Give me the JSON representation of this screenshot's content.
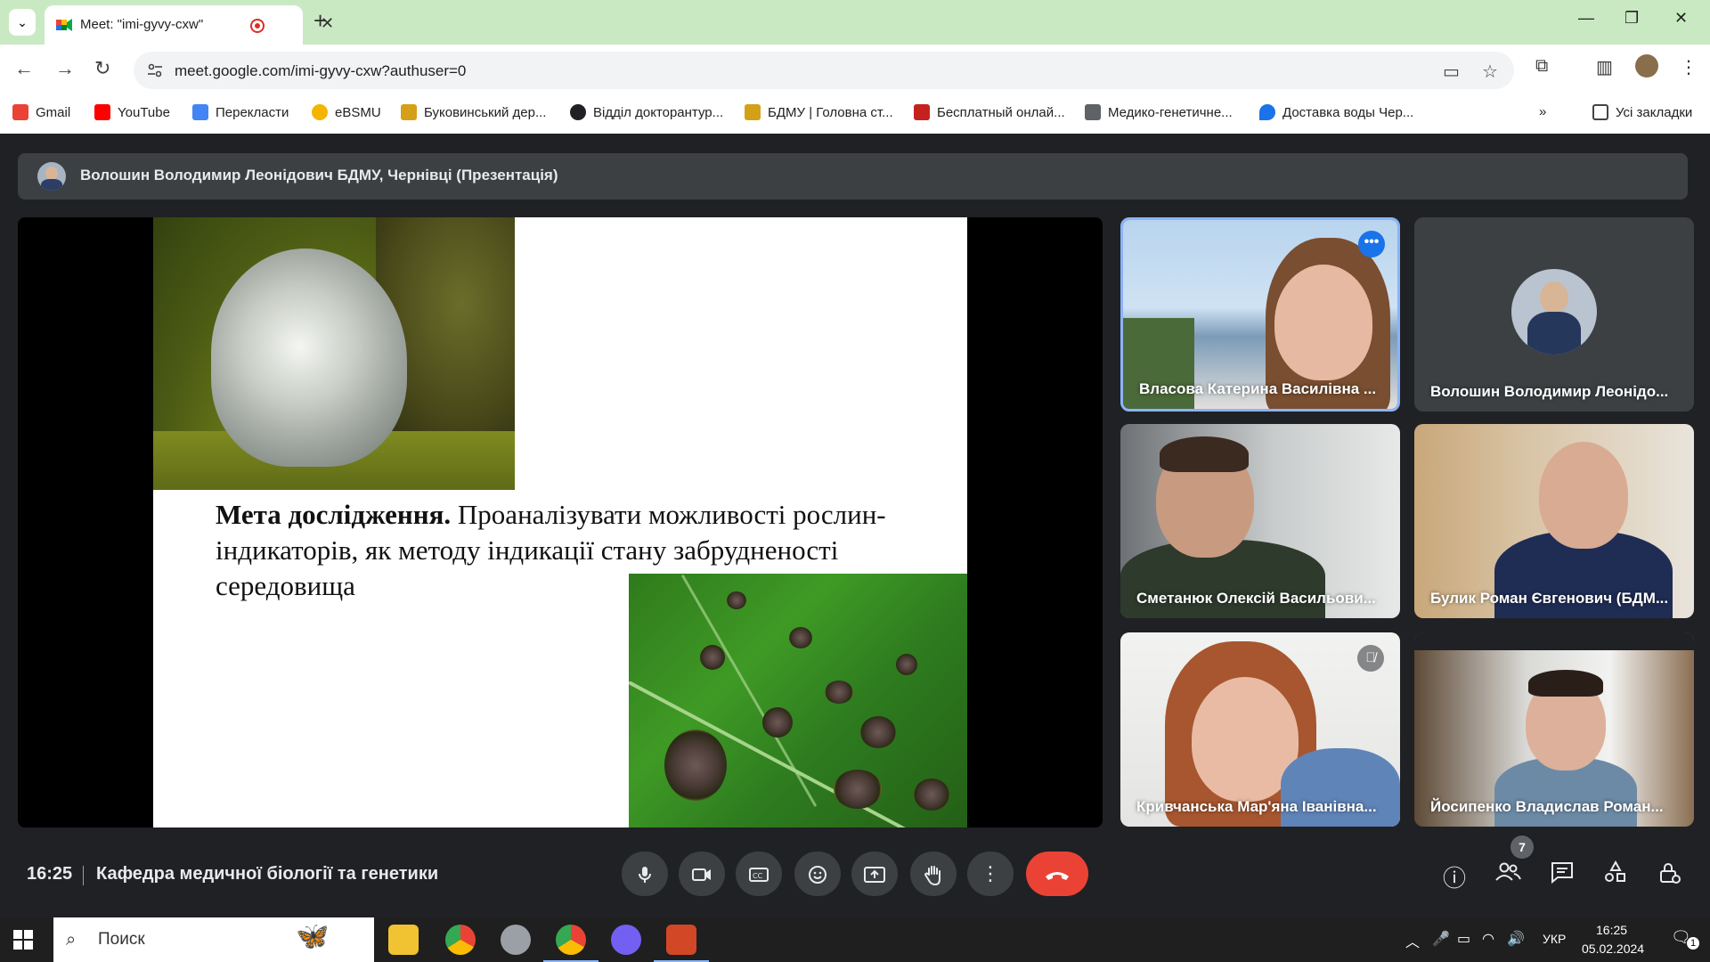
{
  "browser": {
    "tab_title": "Meet: \"imi-gyvy-cxw\"",
    "url": "meet.google.com/imi-gyvy-cxw?authuser=0",
    "bookmarks": [
      {
        "label": "Gmail",
        "color": "#ea4335"
      },
      {
        "label": "YouTube",
        "color": "#ff0000"
      },
      {
        "label": "Перекласти",
        "color": "#4285f4"
      },
      {
        "label": "eBSMU",
        "color": "#f4b400"
      },
      {
        "label": "Буковинський дер...",
        "color": "#f4b400"
      },
      {
        "label": "Відділ докторантур...",
        "color": "#202124"
      },
      {
        "label": "БДМУ | Головна ст...",
        "color": "#d4a017"
      },
      {
        "label": "Бесплатный онлай...",
        "color": "#c5221f"
      },
      {
        "label": "Медико-генетичне...",
        "color": "#5f6368"
      },
      {
        "label": "Доставка воды Чер...",
        "color": "#1a73e8"
      }
    ],
    "all_bookmarks": "Усі закладки"
  },
  "meet": {
    "presenter_bar": "Волошин Володимир Леонідович БДМУ, Чернівці (Презентація)",
    "slide": {
      "heading": "Мета дослідження.",
      "body": " Проаналізувати можливості рослин-індикаторів, як методу індикації стану забрудненості середовища"
    },
    "participants": [
      {
        "name": "Власова Катерина Василівна ..."
      },
      {
        "name": "Волошин Володимир Леонідо..."
      },
      {
        "name": "Сметанюк Олексій Васильови..."
      },
      {
        "name": "Булик Роман Євгенович (БДМ..."
      },
      {
        "name": "Кривчанська Мар'яна Іванівна..."
      },
      {
        "name": "Йосипенко Владислав Роман..."
      }
    ],
    "time": "16:25",
    "meeting_name": "Кафедра медичної біології та генетики",
    "participant_count": "7"
  },
  "taskbar": {
    "search_placeholder": "Поиск",
    "lang": "УКР",
    "clock_time": "16:25",
    "clock_date": "05.02.2024",
    "notif_count": "1"
  }
}
